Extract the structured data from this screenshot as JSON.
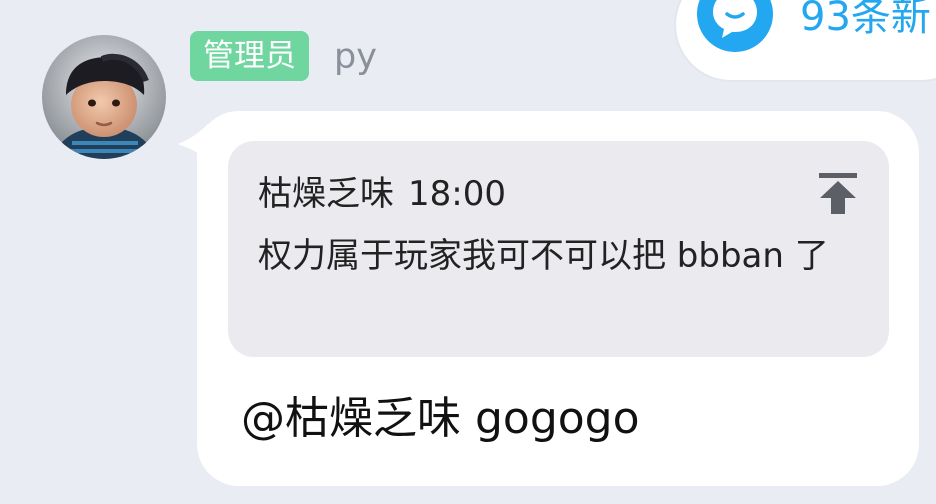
{
  "new_messages": {
    "text": "93条新",
    "icon": "chat-bubble-icon",
    "color": "#22a7f0"
  },
  "sender": {
    "role_badge": "管理员",
    "name": "py",
    "avatar": "avatar",
    "badge_color": "#6fd6a0"
  },
  "quote": {
    "author": "枯燥乏味",
    "time": "18:00",
    "text": "权力属于玩家我可不可以把 bbban 了",
    "icon": "jump-to-top-icon"
  },
  "message": {
    "text": "@枯燥乏味 gogogo"
  }
}
